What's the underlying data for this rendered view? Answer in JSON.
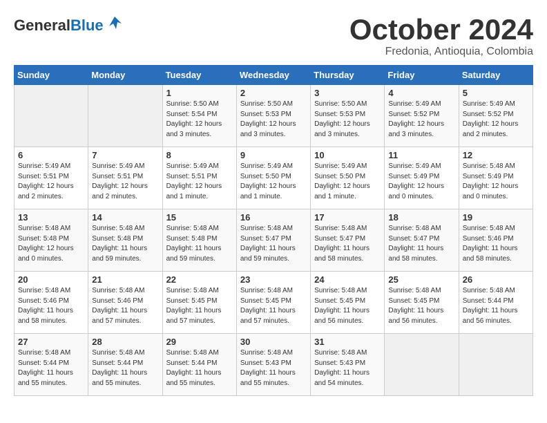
{
  "logo": {
    "general": "General",
    "blue": "Blue"
  },
  "title": "October 2024",
  "location": "Fredonia, Antioquia, Colombia",
  "days_header": [
    "Sunday",
    "Monday",
    "Tuesday",
    "Wednesday",
    "Thursday",
    "Friday",
    "Saturday"
  ],
  "weeks": [
    [
      {
        "num": "",
        "info": ""
      },
      {
        "num": "",
        "info": ""
      },
      {
        "num": "1",
        "info": "Sunrise: 5:50 AM\nSunset: 5:54 PM\nDaylight: 12 hours\nand 3 minutes."
      },
      {
        "num": "2",
        "info": "Sunrise: 5:50 AM\nSunset: 5:53 PM\nDaylight: 12 hours\nand 3 minutes."
      },
      {
        "num": "3",
        "info": "Sunrise: 5:50 AM\nSunset: 5:53 PM\nDaylight: 12 hours\nand 3 minutes."
      },
      {
        "num": "4",
        "info": "Sunrise: 5:49 AM\nSunset: 5:52 PM\nDaylight: 12 hours\nand 3 minutes."
      },
      {
        "num": "5",
        "info": "Sunrise: 5:49 AM\nSunset: 5:52 PM\nDaylight: 12 hours\nand 2 minutes."
      }
    ],
    [
      {
        "num": "6",
        "info": "Sunrise: 5:49 AM\nSunset: 5:51 PM\nDaylight: 12 hours\nand 2 minutes."
      },
      {
        "num": "7",
        "info": "Sunrise: 5:49 AM\nSunset: 5:51 PM\nDaylight: 12 hours\nand 2 minutes."
      },
      {
        "num": "8",
        "info": "Sunrise: 5:49 AM\nSunset: 5:51 PM\nDaylight: 12 hours\nand 1 minute."
      },
      {
        "num": "9",
        "info": "Sunrise: 5:49 AM\nSunset: 5:50 PM\nDaylight: 12 hours\nand 1 minute."
      },
      {
        "num": "10",
        "info": "Sunrise: 5:49 AM\nSunset: 5:50 PM\nDaylight: 12 hours\nand 1 minute."
      },
      {
        "num": "11",
        "info": "Sunrise: 5:49 AM\nSunset: 5:49 PM\nDaylight: 12 hours\nand 0 minutes."
      },
      {
        "num": "12",
        "info": "Sunrise: 5:48 AM\nSunset: 5:49 PM\nDaylight: 12 hours\nand 0 minutes."
      }
    ],
    [
      {
        "num": "13",
        "info": "Sunrise: 5:48 AM\nSunset: 5:48 PM\nDaylight: 12 hours\nand 0 minutes."
      },
      {
        "num": "14",
        "info": "Sunrise: 5:48 AM\nSunset: 5:48 PM\nDaylight: 11 hours\nand 59 minutes."
      },
      {
        "num": "15",
        "info": "Sunrise: 5:48 AM\nSunset: 5:48 PM\nDaylight: 11 hours\nand 59 minutes."
      },
      {
        "num": "16",
        "info": "Sunrise: 5:48 AM\nSunset: 5:47 PM\nDaylight: 11 hours\nand 59 minutes."
      },
      {
        "num": "17",
        "info": "Sunrise: 5:48 AM\nSunset: 5:47 PM\nDaylight: 11 hours\nand 58 minutes."
      },
      {
        "num": "18",
        "info": "Sunrise: 5:48 AM\nSunset: 5:47 PM\nDaylight: 11 hours\nand 58 minutes."
      },
      {
        "num": "19",
        "info": "Sunrise: 5:48 AM\nSunset: 5:46 PM\nDaylight: 11 hours\nand 58 minutes."
      }
    ],
    [
      {
        "num": "20",
        "info": "Sunrise: 5:48 AM\nSunset: 5:46 PM\nDaylight: 11 hours\nand 58 minutes."
      },
      {
        "num": "21",
        "info": "Sunrise: 5:48 AM\nSunset: 5:46 PM\nDaylight: 11 hours\nand 57 minutes."
      },
      {
        "num": "22",
        "info": "Sunrise: 5:48 AM\nSunset: 5:45 PM\nDaylight: 11 hours\nand 57 minutes."
      },
      {
        "num": "23",
        "info": "Sunrise: 5:48 AM\nSunset: 5:45 PM\nDaylight: 11 hours\nand 57 minutes."
      },
      {
        "num": "24",
        "info": "Sunrise: 5:48 AM\nSunset: 5:45 PM\nDaylight: 11 hours\nand 56 minutes."
      },
      {
        "num": "25",
        "info": "Sunrise: 5:48 AM\nSunset: 5:45 PM\nDaylight: 11 hours\nand 56 minutes."
      },
      {
        "num": "26",
        "info": "Sunrise: 5:48 AM\nSunset: 5:44 PM\nDaylight: 11 hours\nand 56 minutes."
      }
    ],
    [
      {
        "num": "27",
        "info": "Sunrise: 5:48 AM\nSunset: 5:44 PM\nDaylight: 11 hours\nand 55 minutes."
      },
      {
        "num": "28",
        "info": "Sunrise: 5:48 AM\nSunset: 5:44 PM\nDaylight: 11 hours\nand 55 minutes."
      },
      {
        "num": "29",
        "info": "Sunrise: 5:48 AM\nSunset: 5:44 PM\nDaylight: 11 hours\nand 55 minutes."
      },
      {
        "num": "30",
        "info": "Sunrise: 5:48 AM\nSunset: 5:43 PM\nDaylight: 11 hours\nand 55 minutes."
      },
      {
        "num": "31",
        "info": "Sunrise: 5:48 AM\nSunset: 5:43 PM\nDaylight: 11 hours\nand 54 minutes."
      },
      {
        "num": "",
        "info": ""
      },
      {
        "num": "",
        "info": ""
      }
    ]
  ]
}
